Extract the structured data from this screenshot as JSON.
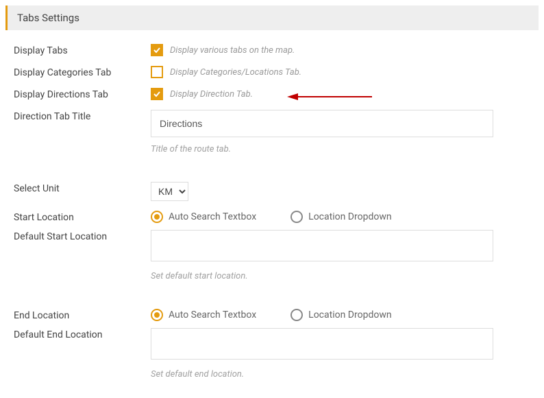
{
  "header": {
    "title": "Tabs Settings"
  },
  "rows": {
    "display_tabs": {
      "label": "Display Tabs",
      "hint": "Display various tabs on the map."
    },
    "display_categories": {
      "label": "Display Categories Tab",
      "hint": "Display Categories/Locations Tab."
    },
    "display_directions": {
      "label": "Display Directions Tab",
      "hint": "Display Direction Tab."
    },
    "direction_tab_title": {
      "label": "Direction Tab Title",
      "value": "Directions",
      "help": "Title of the route tab."
    },
    "select_unit": {
      "label": "Select Unit",
      "value": "KM",
      "options": [
        "KM"
      ]
    },
    "start_location": {
      "label": "Start Location",
      "options": {
        "auto": "Auto Search Textbox",
        "dropdown": "Location Dropdown"
      }
    },
    "default_start": {
      "label": "Default Start Location",
      "value": "",
      "help": "Set default start location."
    },
    "end_location": {
      "label": "End Location",
      "options": {
        "auto": "Auto Search Textbox",
        "dropdown": "Location Dropdown"
      }
    },
    "default_end": {
      "label": "Default End Location",
      "value": "",
      "help": "Set default end location."
    }
  }
}
